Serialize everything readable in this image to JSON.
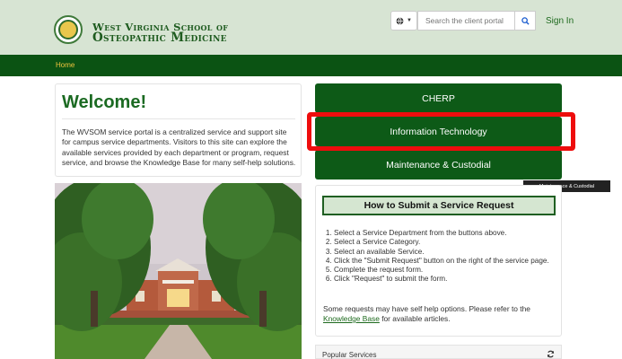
{
  "header": {
    "logo_line1": "West Virginia School of",
    "logo_line2": "Osteopathic Medicine",
    "language_icon": "globe-icon",
    "search_placeholder": "Search the client portal",
    "sign_in": "Sign In"
  },
  "breadcrumb": {
    "home": "Home"
  },
  "welcome": {
    "title": "Welcome!",
    "body": "The WVSOM service portal is a centralized service and support site for campus service departments. Visitors to this site can explore the available services provided by each department or program, request service, and browse the Knowledge Base for many self-help solutions."
  },
  "departments": [
    {
      "label": "CHERP"
    },
    {
      "label": "Information Technology"
    },
    {
      "label": "Maintenance & Custodial"
    }
  ],
  "tooltip": "Maintenance & Custodial",
  "howto": {
    "title": "How to Submit a Service Request",
    "steps": [
      "Select a Service Department from the buttons above.",
      "Select a Service Category.",
      "Select an available Service.",
      "Click the \"Submit Request\" button on the right of the service page.",
      "Complete the request form.",
      "Click \"Request\" to submit the form."
    ],
    "note_prefix": "Some requests may have self help options. Please refer to the",
    "note_link": "Knowledge Base",
    "note_suffix": "for available articles."
  },
  "popular": {
    "title": "Popular Services",
    "icon": "refresh-icon"
  },
  "colors": {
    "brand_green": "#0b5313",
    "accent_gold": "#f0c43e",
    "highlight_red": "#ee0d0d"
  }
}
